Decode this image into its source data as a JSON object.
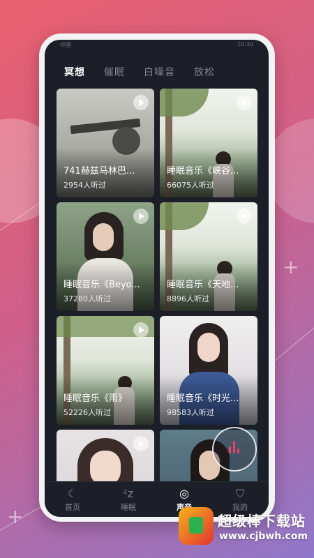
{
  "status_bar": {
    "left": "中国",
    "right": "10:30"
  },
  "tabs": [
    {
      "label": "冥想",
      "active": true
    },
    {
      "label": "催眠",
      "active": false
    },
    {
      "label": "白噪音",
      "active": false
    },
    {
      "label": "放松",
      "active": false
    }
  ],
  "cards": [
    {
      "title": "741赫兹马林巴...",
      "count": "2954人听过",
      "icon": "play-icon"
    },
    {
      "title": "睡眠音乐《峡谷...",
      "count": "66075人听过",
      "icon": "play-icon"
    },
    {
      "title": "睡眠音乐《Beyo...",
      "count": "37280人听过",
      "icon": "play-icon"
    },
    {
      "title": "睡眠音乐《天地...",
      "count": "8896人听过",
      "icon": "play-icon"
    },
    {
      "title": "睡眠音乐《雨》",
      "count": "52226人听过",
      "icon": "play-icon"
    },
    {
      "title": "睡眠音乐《时光...",
      "count": "98583人听过",
      "icon": "play-icon"
    },
    {
      "title": "",
      "count": "",
      "icon": "play-icon"
    },
    {
      "title": "",
      "count": "",
      "icon": ""
    }
  ],
  "nav": [
    {
      "label": "首页",
      "icon": "moon-icon",
      "active": false
    },
    {
      "label": "睡眠",
      "icon": "sleep-z-icon",
      "active": false
    },
    {
      "label": "声音",
      "icon": "sound-icon",
      "active": true
    },
    {
      "label": "我的",
      "icon": "user-icon",
      "active": false
    }
  ],
  "watermark": {
    "title": "超级棒下载站",
    "url": "www.cjbwh.com"
  },
  "colors": {
    "accent": "#e8436b",
    "screen_bg": "#1c1f27"
  }
}
